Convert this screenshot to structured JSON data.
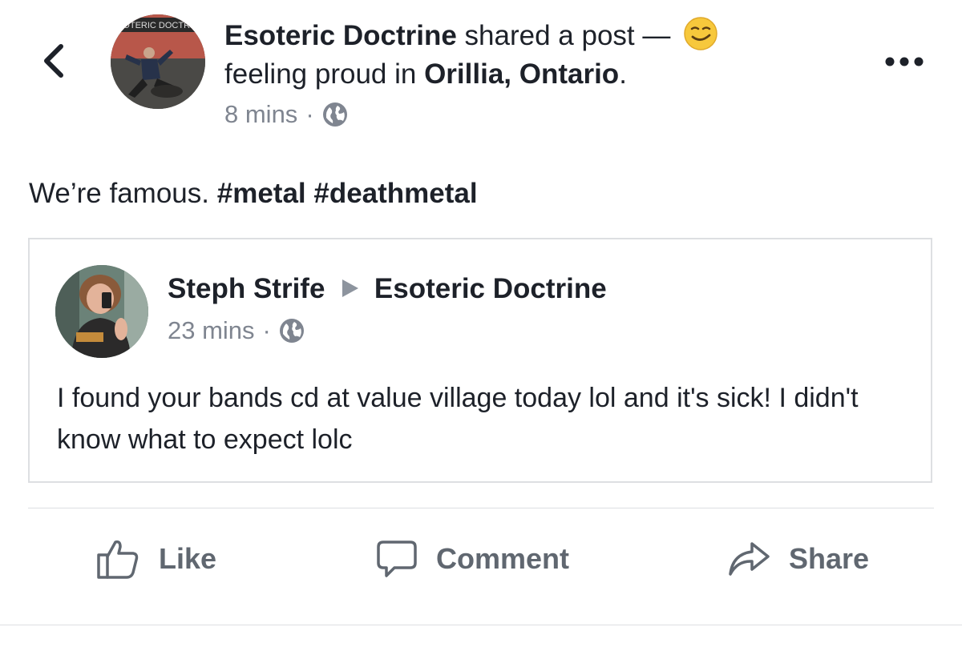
{
  "header": {
    "author": "Esoteric Doctrine",
    "action_text": "shared a post —",
    "feeling_text": "feeling proud in",
    "location": "Orillia, Ontario",
    "location_suffix": ".",
    "time": "8 mins",
    "separator": "·",
    "avatar_banner_text": "ESOTERIC DOCTRINE"
  },
  "post": {
    "text": "We’re famous.",
    "hashtags": [
      "#metal",
      "#deathmetal"
    ]
  },
  "shared_post": {
    "author": "Steph Strife",
    "target": "Esoteric Doctrine",
    "time": "23 mins",
    "separator": "·",
    "text": "I found your bands cd at value village today lol and it's sick! I didn't know what to expect lolc"
  },
  "actions": {
    "like_label": "Like",
    "comment_label": "Comment",
    "share_label": "Share"
  },
  "icons": {
    "back": "chevron-left-icon",
    "more": "more-dots-icon",
    "privacy": "globe-icon",
    "feeling": "smiling-emoji-icon",
    "arrow": "triangle-right-icon",
    "like": "thumbs-up-icon",
    "comment": "speech-bubble-icon",
    "share": "share-arrow-icon"
  },
  "colors": {
    "text_primary": "#1d2129",
    "text_secondary": "#7f8590",
    "action_text": "#606770",
    "divider": "#dddfe2",
    "emoji_yellow": "#f7c83c"
  }
}
